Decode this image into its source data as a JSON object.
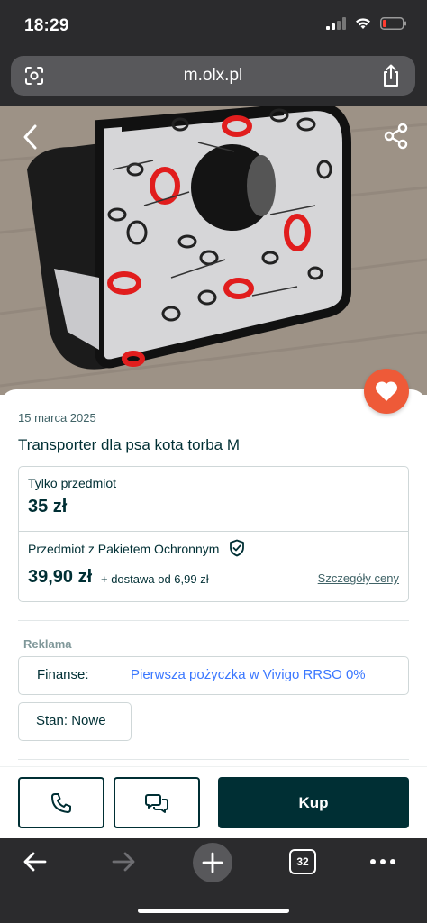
{
  "status_bar": {
    "time": "18:29"
  },
  "browser": {
    "url": "m.olx.pl",
    "tab_count": "32"
  },
  "listing": {
    "date": "15 marca 2025",
    "title": "Transporter dla psa kota torba M",
    "item_only_label": "Tylko przedmiot",
    "item_only_price": "35 zł",
    "package_label": "Przedmiot z Pakietem Ochronnym",
    "package_price": "39,90 zł",
    "delivery_text": "+ dostawa od 6,99 zł",
    "price_details_link": "Szczegóły ceny"
  },
  "ad": {
    "label": "Reklama",
    "key": "Finanse:",
    "value": "Pierwsza pożyczka w Vivigo RRSO 0%"
  },
  "condition": "Stan: Nowe",
  "actions": {
    "buy_label": "Kup"
  },
  "colors": {
    "olx_dark": "#002f34",
    "heart": "#ee5a38",
    "browser_chrome": "#2b2b2d",
    "ad_link": "#3a77ff"
  },
  "icons": [
    "camera-lens-icon",
    "share-icon",
    "back-chevron-icon",
    "share-nodes-icon",
    "heart-icon",
    "shield-check-icon",
    "phone-icon",
    "chat-icon",
    "arrow-left-icon",
    "arrow-right-icon",
    "plus-icon",
    "tabs-icon",
    "more-icon"
  ]
}
